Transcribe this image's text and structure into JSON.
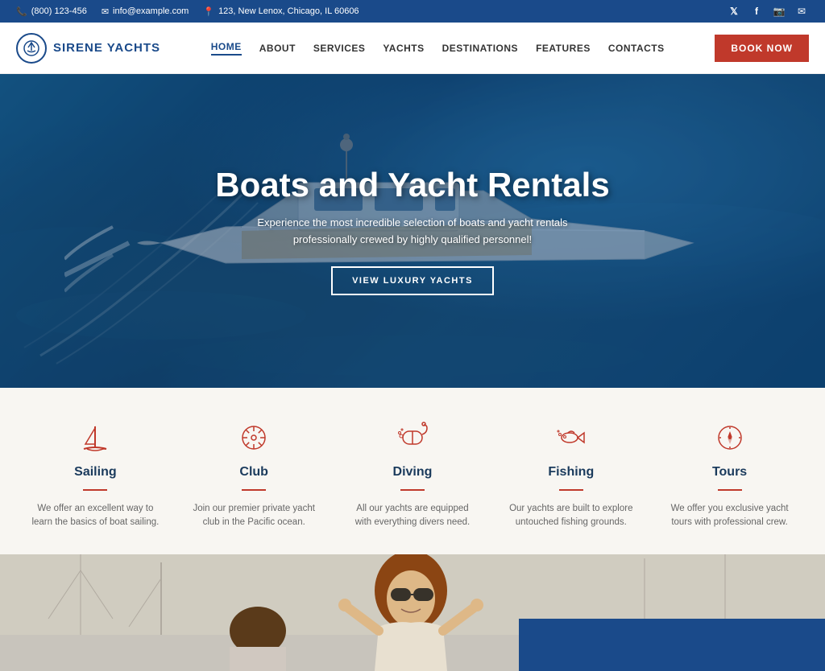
{
  "topbar": {
    "phone": "(800) 123-456",
    "email": "info@example.com",
    "address": "123, New Lenox, Chicago, IL 60606",
    "social": [
      "twitter",
      "facebook",
      "instagram",
      "email"
    ]
  },
  "header": {
    "logo_text": "SIRENE YACHTS",
    "nav_items": [
      {
        "label": "HOME",
        "active": true
      },
      {
        "label": "ABOUT",
        "active": false
      },
      {
        "label": "SERVICES",
        "active": false
      },
      {
        "label": "YACHTS",
        "active": false
      },
      {
        "label": "DESTINATIONS",
        "active": false
      },
      {
        "label": "FEATURES",
        "active": false
      },
      {
        "label": "CONTACTS",
        "active": false
      }
    ],
    "book_label": "BOOK NOW"
  },
  "hero": {
    "title": "Boats and Yacht Rentals",
    "subtitle": "Experience the most incredible selection of boats and yacht rentals professionally crewed by highly qualified personnel!",
    "cta_label": "VIEW LUXURY YACHTS"
  },
  "services": [
    {
      "id": "sailing",
      "title": "Sailing",
      "desc": "We offer an excellent way to learn the basics of boat sailing.",
      "icon": "⛵"
    },
    {
      "id": "club",
      "title": "Club",
      "desc": "Join our premier private yacht club in the Pacific ocean.",
      "icon": "☸"
    },
    {
      "id": "diving",
      "title": "Diving",
      "desc": "All our yachts are equipped with everything divers need.",
      "icon": "🤿"
    },
    {
      "id": "fishing",
      "title": "Fishing",
      "desc": "Our yachts are built to explore untouched fishing grounds.",
      "icon": "🐟"
    },
    {
      "id": "tours",
      "title": "Tours",
      "desc": "We offer you exclusive yacht tours with professional crew.",
      "icon": "🧭"
    }
  ]
}
